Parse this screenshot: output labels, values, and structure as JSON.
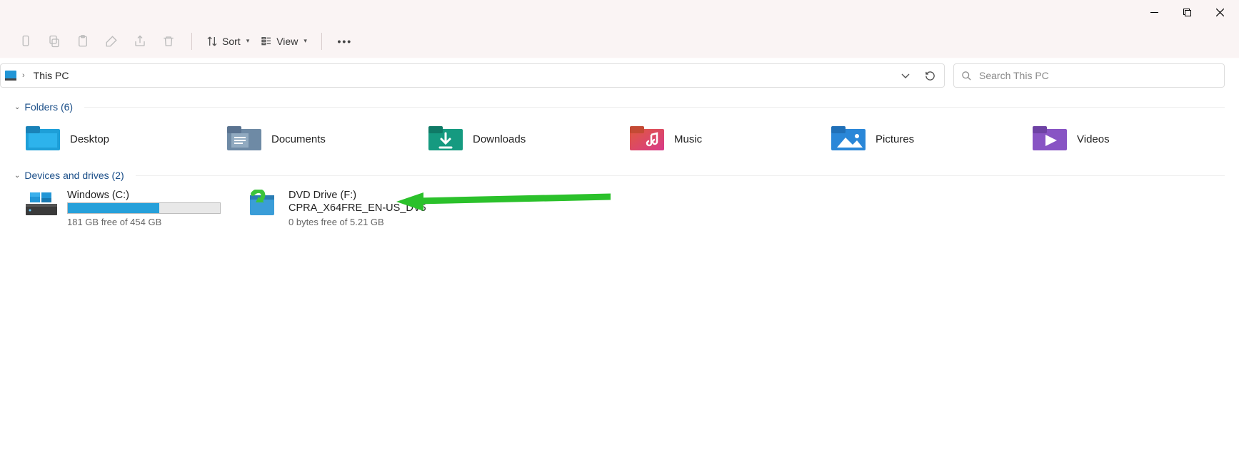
{
  "toolbar": {
    "sort_label": "Sort",
    "view_label": "View"
  },
  "address": {
    "location": "This PC"
  },
  "search": {
    "placeholder": "Search This PC"
  },
  "groups": {
    "folders": {
      "title": "Folders (6)",
      "items": [
        "Desktop",
        "Documents",
        "Downloads",
        "Music",
        "Pictures",
        "Videos"
      ]
    },
    "drives": {
      "title": "Devices and drives (2)",
      "c": {
        "name": "Windows (C:)",
        "free": "181 GB free of 454 GB",
        "fill_percent": 60
      },
      "f": {
        "name_line1": "DVD Drive (F:)",
        "name_line2": "CPRA_X64FRE_EN-US_DV5",
        "free": "0 bytes free of 5.21 GB"
      }
    }
  }
}
